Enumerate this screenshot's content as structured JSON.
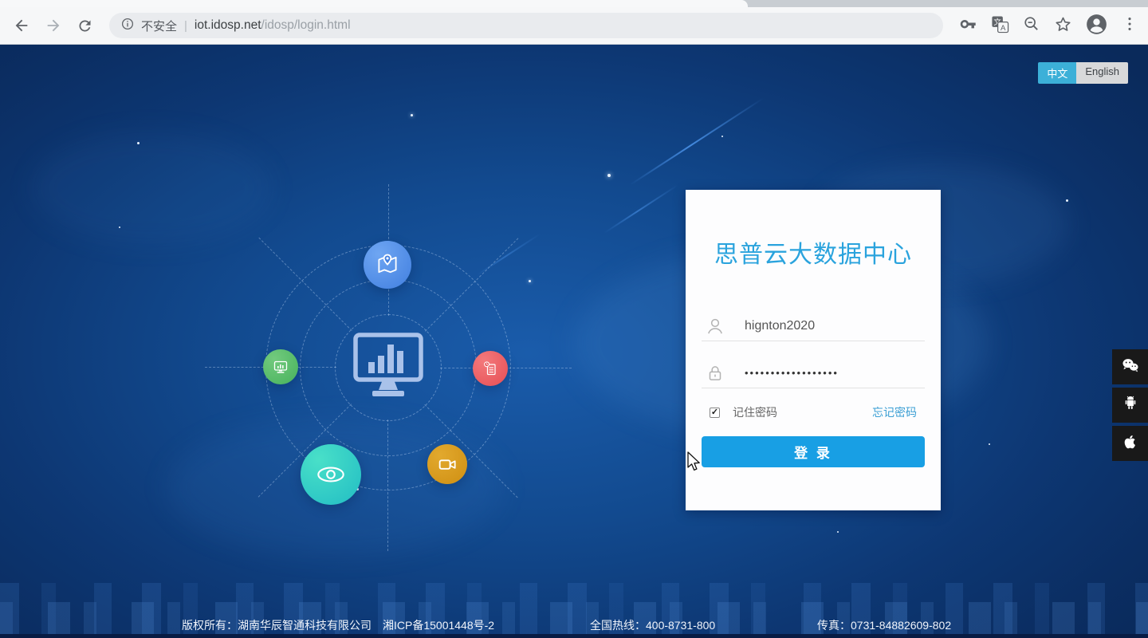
{
  "browser": {
    "security_label": "不安全",
    "separator": "|",
    "host": "iot.idosp.net",
    "path": "/idosp/login.html"
  },
  "language_toggle": {
    "chinese": "中文",
    "english": "English"
  },
  "login": {
    "title": "思普云大数据中心",
    "username_value": "hignton2020",
    "password_mask": "••••••••••••••••••",
    "remember_label": "记住密码",
    "checkbox_check": "✓",
    "forgot_label": "忘记密码",
    "submit_label": "登 录"
  },
  "footer": {
    "copyright": "版权所有：湖南华辰智通科技有限公司",
    "icp": "湘ICP备15001448号-2",
    "hotline": "全国热线：400-8731-800",
    "fax": "传真：0731-84882609-802"
  },
  "colors": {
    "accent_title": "#2aa3dd",
    "login_button": "#189fe4",
    "lang_active": "#3cb0d8",
    "forgot_link": "#3b9fd4",
    "background_deep": "#0b2e63",
    "background_glow": "#1a5cab"
  },
  "icons": {
    "browser": [
      "back-arrow",
      "forward-arrow",
      "reload",
      "info-circle",
      "key",
      "translate",
      "zoom-out",
      "bookmark-star",
      "profile-avatar",
      "menu-dots"
    ],
    "login": [
      "user-icon",
      "lock-icon"
    ],
    "diagram_center": "dashboard-monitor",
    "diagram_satellites": [
      "map-pin",
      "mini-monitor",
      "report-clock",
      "eye",
      "video-camera"
    ],
    "side_apps": [
      "wechat",
      "android",
      "apple"
    ]
  }
}
